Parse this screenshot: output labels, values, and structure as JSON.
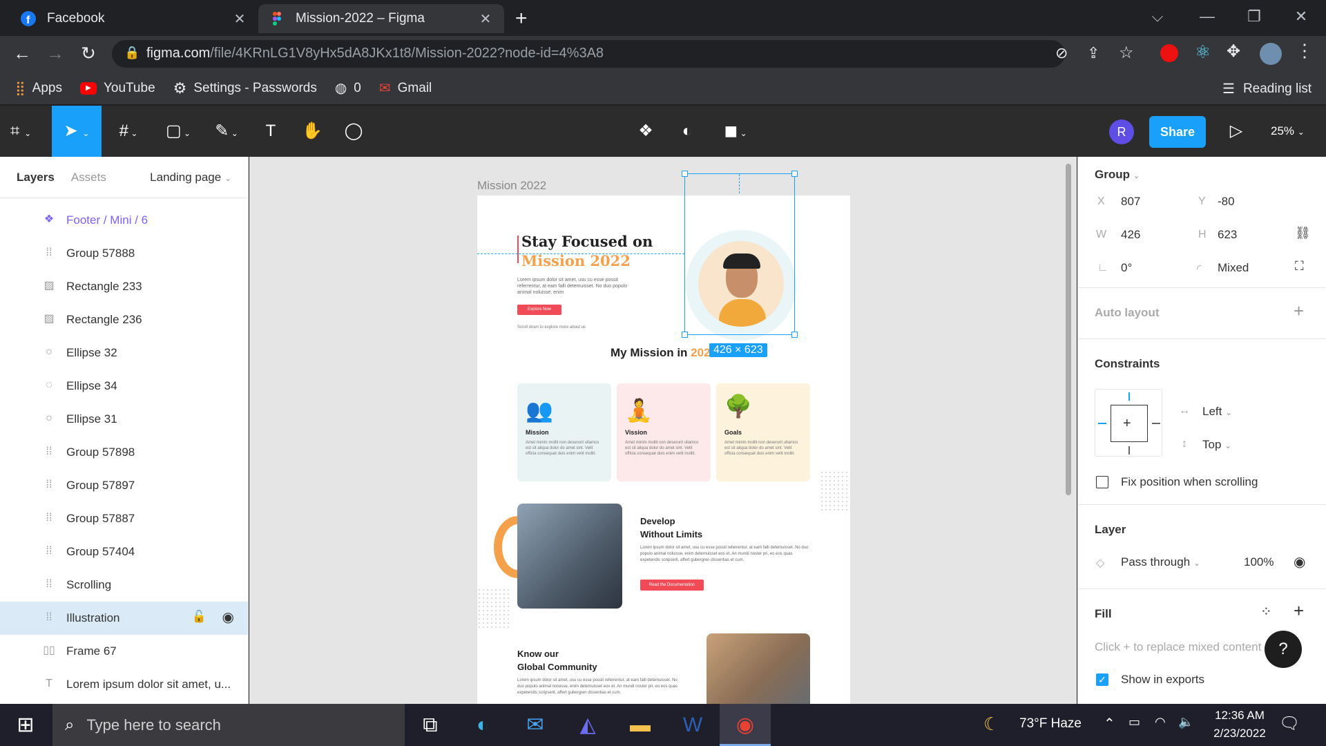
{
  "browser": {
    "tabs": [
      {
        "title": "Facebook",
        "active": false
      },
      {
        "title": "Mission-2022 – Figma",
        "active": true
      }
    ],
    "url_domain": "figma.com",
    "url_path": "/file/4KRnLG1V8yHx5dA8JKx1t8/Mission-2022?node-id=4%3A8",
    "bookmarks": [
      {
        "label": "Apps",
        "icon": "apps-grid-icon"
      },
      {
        "label": "YouTube",
        "icon": "youtube-icon"
      },
      {
        "label": "Settings - Passwords",
        "icon": "settings-gear-icon"
      },
      {
        "label": "0",
        "icon": "globe-icon"
      },
      {
        "label": "Gmail",
        "icon": "gmail-icon"
      }
    ],
    "reading_list": "Reading list"
  },
  "figma": {
    "avatar_initial": "R",
    "share_label": "Share",
    "zoom": "25%",
    "left_panel": {
      "tabs": [
        "Layers",
        "Assets"
      ],
      "page": "Landing page",
      "layers": [
        {
          "name": "Footer / Mini / 6",
          "icon": "component-icon",
          "type": "component"
        },
        {
          "name": "Group 57888",
          "icon": "group-icon",
          "type": "group"
        },
        {
          "name": "Rectangle 233",
          "icon": "image-icon",
          "type": "image"
        },
        {
          "name": "Rectangle 236",
          "icon": "image-icon",
          "type": "image"
        },
        {
          "name": "Ellipse 32",
          "icon": "ellipse-icon",
          "type": "ellipse"
        },
        {
          "name": "Ellipse 34",
          "icon": "ellipse-arc-icon",
          "type": "ellipse"
        },
        {
          "name": "Ellipse 31",
          "icon": "ellipse-icon",
          "type": "ellipse"
        },
        {
          "name": "Group 57898",
          "icon": "group-icon",
          "type": "group"
        },
        {
          "name": "Group 57897",
          "icon": "group-icon",
          "type": "group"
        },
        {
          "name": "Group 57887",
          "icon": "group-icon",
          "type": "group"
        },
        {
          "name": "Group 57404",
          "icon": "group-icon",
          "type": "group"
        },
        {
          "name": "Scrolling",
          "icon": "group-icon",
          "type": "group"
        },
        {
          "name": "Illustration",
          "icon": "group-icon",
          "type": "group",
          "selected": true
        },
        {
          "name": "Frame 67",
          "icon": "frame-icon",
          "type": "frame"
        },
        {
          "name": "Lorem ipsum dolor sit amet, u...",
          "icon": "text-icon",
          "type": "text"
        }
      ]
    },
    "canvas": {
      "frame_label": "Mission 2022",
      "selection_size": "426 × 623",
      "hero": {
        "title_line1": "Stay Focused on",
        "title_line2": "Mission 2022",
        "body": "Lorem ipsum dolor sit amet, usu cu esse possit referrentur, at eam falli detemuisset. No duo populo animal noluisse, enim",
        "button": "Explore Now",
        "scroll_hint": "Scroll down to explore more about us"
      },
      "mission_heading_a": "My Mission in ",
      "mission_heading_b": "2022",
      "cards": [
        {
          "title": "Mission",
          "text": "Amet minim mollit non deserunt ullamco est sit aliqua dolor do amet sint. Velit officia consequat duis enim velit mollit.",
          "bg": "#e9f3f4"
        },
        {
          "title": "Vission",
          "text": "Amet minim mollit non deserunt ullamco est sit aliqua dolor do amet sint. Velit officia consequat duis enim velit mollit.",
          "bg": "#fde9e9"
        },
        {
          "title": "Goals",
          "text": "Amet minim mollit non deserunt ullamco est sit aliqua dolor do amet sint. Velit officia consequat duis enim velit mollit.",
          "bg": "#fdf2dc"
        }
      ],
      "develop": {
        "title_line1": "Develop",
        "title_line2": "Without Limits",
        "body": "Lorem ipsum dolor sit amet, usu cu esse possit referrentur, at eam falli detemuisset. No duo populo animal noluisse, enim detemuisset eos et. An mundi noster pri, eo eos quas expetendis scripserit, affert gubergren dissentias et cum.",
        "button": "Read the Documentation"
      },
      "community": {
        "title_line1": "Know our",
        "title_line2": "Global Community",
        "body": "Lorem ipsum dolor sit amet, usu cu esse possit referrentur, at eam falli detemuisset. No duo populo animal noluisse, enim detemuisset eos et. An mundi noster pri, eo eos quas expetendis scripserit, affert gubergren dissentias et cum."
      },
      "accent_color": "#f5a04b",
      "button_color": "#f04b57"
    },
    "right_panel": {
      "group_label": "Group",
      "x_label": "X",
      "x": "807",
      "y_label": "Y",
      "y": "-80",
      "w_label": "W",
      "w": "426",
      "h_label": "H",
      "h": "623",
      "rotation": "0°",
      "radius": "Mixed",
      "auto_layout": "Auto layout",
      "constraints": "Constraints",
      "constraint_h": "Left",
      "constraint_v": "Top",
      "fix_position": "Fix position when scrolling",
      "layer": "Layer",
      "blend": "Pass through",
      "opacity": "100%",
      "fill": "Fill",
      "fill_hint": "Click + to replace mixed content",
      "show_exports": "Show in exports",
      "help": "?"
    }
  },
  "taskbar": {
    "search_placeholder": "Type here to search",
    "weather": "73°F  Haze",
    "time": "12:36 AM",
    "date": "2/23/2022"
  }
}
